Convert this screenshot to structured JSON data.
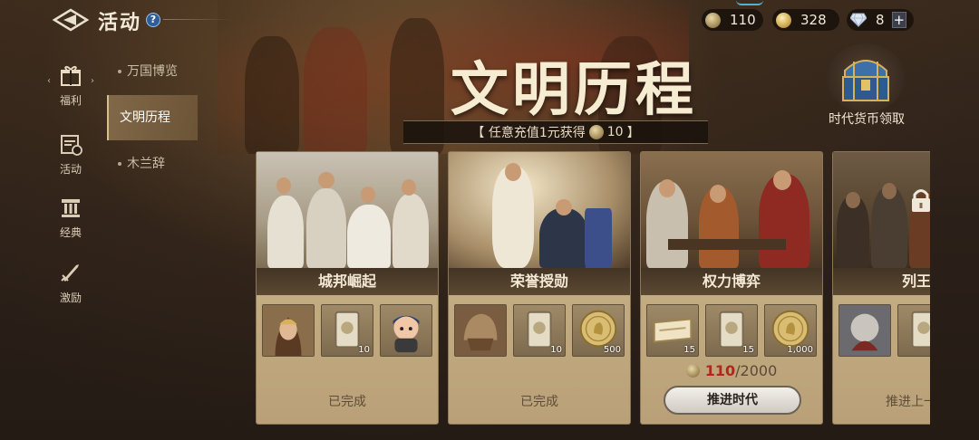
{
  "header": {
    "title": "活动",
    "big_title": "文明历程",
    "promo_prefix": "【 任意充值1元获得",
    "promo_amount": "10",
    "promo_suffix": "】"
  },
  "currencies": [
    {
      "name": "civ-coin",
      "value": "110"
    },
    {
      "name": "gold-coin",
      "value": "328"
    },
    {
      "name": "diamond",
      "value": "8"
    }
  ],
  "rail": {
    "items": [
      {
        "label": "福利",
        "icon": "gift-icon"
      },
      {
        "label": "活动",
        "icon": "calendar-icon"
      },
      {
        "label": "经典",
        "icon": "pillar-icon"
      },
      {
        "label": "激励",
        "icon": "sword-icon"
      }
    ]
  },
  "submenu": {
    "items": [
      {
        "label": "万国博览",
        "active": false
      },
      {
        "label": "文明历程",
        "active": true
      },
      {
        "label": "木兰辞",
        "active": false
      }
    ]
  },
  "chest": {
    "label": "时代货币领取"
  },
  "cards": [
    {
      "title": "城邦崛起",
      "rewards": [
        {
          "icon": "woman-portrait-icon",
          "qty": ""
        },
        {
          "icon": "card-pack-icon",
          "qty": "10"
        },
        {
          "icon": "mascot-avatar-icon",
          "qty": ""
        }
      ],
      "status": "已完成"
    },
    {
      "title": "荣誉授勋",
      "rewards": [
        {
          "icon": "warrior-helmet-icon",
          "qty": ""
        },
        {
          "icon": "card-pack-icon",
          "qty": "10"
        },
        {
          "icon": "gold-coin-icon",
          "qty": "500"
        }
      ],
      "status": "已完成"
    },
    {
      "title": "权力博弈",
      "rewards": [
        {
          "icon": "ticket-icon",
          "qty": "15"
        },
        {
          "icon": "card-pack-icon",
          "qty": "15"
        },
        {
          "icon": "gold-coin-icon",
          "qty": "1,000"
        }
      ],
      "progress_current": "110",
      "progress_total": "/2000",
      "button": "推进时代"
    },
    {
      "title": "列王纪",
      "rewards": [
        {
          "icon": "knight-portrait-icon",
          "qty": ""
        },
        {
          "icon": "card-pack-icon",
          "qty": ""
        }
      ],
      "status": "推进上一时代",
      "locked": true
    }
  ],
  "colors": {
    "accent": "#d7bf8a",
    "progress_current": "#b3261e",
    "card_bg": "#c2aa80"
  }
}
